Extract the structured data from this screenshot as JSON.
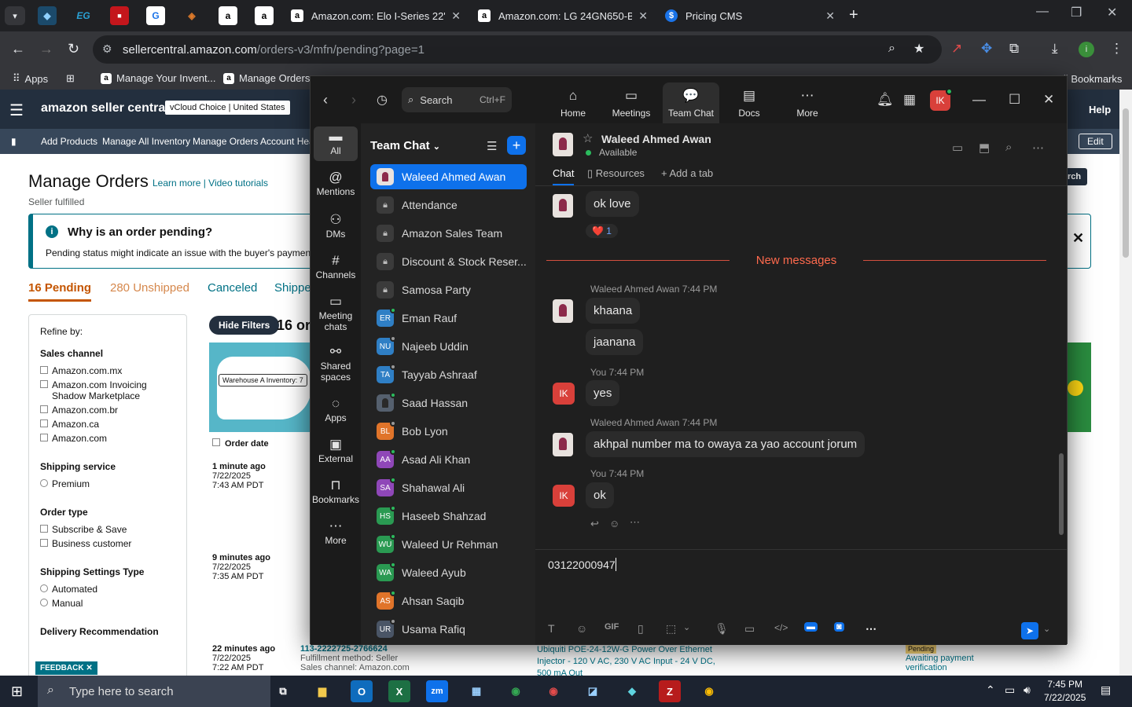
{
  "browser": {
    "tabs": [
      {
        "title": "Amazon.com: Elo I-Series 22\" To"
      },
      {
        "title": "Amazon.com: LG 24GN650-B Ul"
      },
      {
        "title": "Pricing CMS"
      }
    ],
    "url_host": "sellercentral.amazon.com",
    "url_path": "/orders-v3/mfn/pending?page=1",
    "bookmarks": [
      "Apps",
      "Manage Your Invent...",
      "Manage Orders",
      "All Bookmarks"
    ]
  },
  "amazon": {
    "logo": "amazon seller central",
    "store_badge": "vCloud Choice | United States",
    "help": "Help",
    "nav": [
      "Add Products",
      "Manage All Inventory",
      "Manage Orders",
      "Account Heal"
    ],
    "edit": "Edit",
    "page_title": "Manage Orders",
    "learn_more": "Learn more",
    "video_tutorials": "Video tutorials",
    "subtitle": "Seller fulfilled",
    "banner_title": "Why is an order pending?",
    "banner_body": "Pending status might indicate an issue with the buyer's payment m",
    "tabs": [
      "16 Pending",
      "280 Unshipped",
      "Canceled",
      "Shippe"
    ],
    "refine_by": "Refine by:",
    "filters": [
      {
        "heading": "Sales channel",
        "options": [
          "Amazon.com.mx",
          "Amazon.com Invoicing Shadow Marketplace",
          "Amazon.com.br",
          "Amazon.ca",
          "Amazon.com"
        ]
      },
      {
        "heading": "Shipping service",
        "options": [
          "Premium"
        ]
      },
      {
        "heading": "Order type",
        "options": [
          "Subscribe & Save",
          "Business customer"
        ]
      },
      {
        "heading": "Shipping Settings Type",
        "options": [
          "Automated",
          "Manual"
        ]
      },
      {
        "heading": "Delivery Recommendation",
        "options": []
      }
    ],
    "hide_filters": "Hide Filters",
    "orders_count": "16 or",
    "map_label": "Warehouse A Inventory: 7",
    "order_date_header": "Order date",
    "orders": [
      {
        "ago": "1 minute ago",
        "date": "7/22/2025",
        "time": "7:43 AM PDT"
      },
      {
        "ago": "9 minutes ago",
        "date": "7/22/2025",
        "time": "7:35 AM PDT"
      },
      {
        "ago": "22 minutes ago",
        "date": "7/22/2025",
        "time": "7:22 AM PDT"
      }
    ],
    "order_id": "113-2222725-2766624",
    "fulfillment": "Fulfillment method: Seller",
    "sales_channel": "Sales channel: Amazon.com",
    "product": "Ubiquiti POE-24-12W-G Power Over Ethernet Injector - 120 V AC, 230 V AC Input - 24 V DC, 500 mA Out",
    "pending_badge": "Pending",
    "awaiting": "Awaiting payment",
    "verification": "verification",
    "search_btn": "rch",
    "feedback": "FEEDBACK"
  },
  "zoom": {
    "search_label": "Search",
    "search_shortcut": "Ctrl+F",
    "top_tabs": [
      "Home",
      "Meetings",
      "Team Chat",
      "Docs",
      "More"
    ],
    "me_initials": "IK",
    "rail": [
      "All",
      "Mentions",
      "DMs",
      "Channels",
      "Meeting chats",
      "Shared spaces",
      "Apps",
      "External",
      "Bookmarks",
      "More"
    ],
    "list_title": "Team Chat",
    "contacts": [
      {
        "name": "Waleed Ahmed Awan",
        "type": "photo",
        "status": ""
      },
      {
        "name": "Attendance",
        "type": "lock"
      },
      {
        "name": "Amazon Sales Team",
        "type": "lock"
      },
      {
        "name": "Discount & Stock Reser...",
        "type": "lock"
      },
      {
        "name": "Samosa Party",
        "type": "lock"
      },
      {
        "name": "Eman Rauf",
        "initials": "ER",
        "color": "#2f7fc5",
        "status": "#2bbb5d"
      },
      {
        "name": "Najeeb Uddin",
        "initials": "NU",
        "color": "#2f7fc5",
        "status": "#9a9a9a"
      },
      {
        "name": "Tayyab Ashraaf",
        "initials": "TA",
        "color": "#2f7fc5",
        "status": "#9a9a9a"
      },
      {
        "name": "Saad Hassan",
        "type": "photo2",
        "status": "#2bbb5d"
      },
      {
        "name": "Bob Lyon",
        "initials": "BL",
        "color": "#e0742a",
        "status": "#9a9a9a"
      },
      {
        "name": "Asad Ali Khan",
        "initials": "AA",
        "color": "#8f47b8",
        "status": "#2bbb5d"
      },
      {
        "name": "Shahawal Ali",
        "initials": "SA",
        "color": "#8f47b8",
        "status": "#2bbb5d"
      },
      {
        "name": "Haseeb Shahzad",
        "initials": "HS",
        "color": "#2a9a52",
        "status": "#2bbb5d"
      },
      {
        "name": "Waleed Ur Rehman",
        "initials": "WU",
        "color": "#2a9a52",
        "status": "#2bbb5d"
      },
      {
        "name": "Waleed Ayub",
        "initials": "WA",
        "color": "#2a9a52",
        "status": "#2bbb5d"
      },
      {
        "name": "Ahsan Saqib",
        "initials": "AS",
        "color": "#e0742a",
        "status": "#2bbb5d"
      },
      {
        "name": "Usama Rafiq",
        "initials": "UR",
        "color": "#4a5566",
        "status": "#9a9a9a"
      }
    ],
    "chat_name": "Waleed Ahmed Awan",
    "chat_status": "Available",
    "chat_tabs": [
      "Chat",
      "Resources",
      "Add a tab"
    ],
    "new_messages": "New messages",
    "messages": [
      {
        "type": "text",
        "who": "other",
        "text": "ok love"
      },
      {
        "type": "reaction",
        "text": "❤️ 1"
      },
      {
        "type": "head",
        "who": "other",
        "text": "Waleed Ahmed Awan 7:44 PM"
      },
      {
        "type": "text",
        "who": "other",
        "text": "khaana"
      },
      {
        "type": "text",
        "who": "other",
        "text": "jaanana"
      },
      {
        "type": "head",
        "who": "me",
        "text": "You 7:44 PM"
      },
      {
        "type": "text",
        "who": "me",
        "text": "yes"
      },
      {
        "type": "head",
        "who": "other",
        "text": "Waleed Ahmed Awan 7:44 PM"
      },
      {
        "type": "text",
        "who": "other",
        "text": "akhpal number ma to owaya za yao account jorum"
      },
      {
        "type": "head",
        "who": "me",
        "text": "You 7:44 PM"
      },
      {
        "type": "text",
        "who": "me",
        "text": "ok"
      }
    ],
    "compose_value": "03122000947"
  },
  "taskbar": {
    "search_placeholder": "Type here to search",
    "time": "7:45 PM",
    "date": "7/22/2025"
  }
}
